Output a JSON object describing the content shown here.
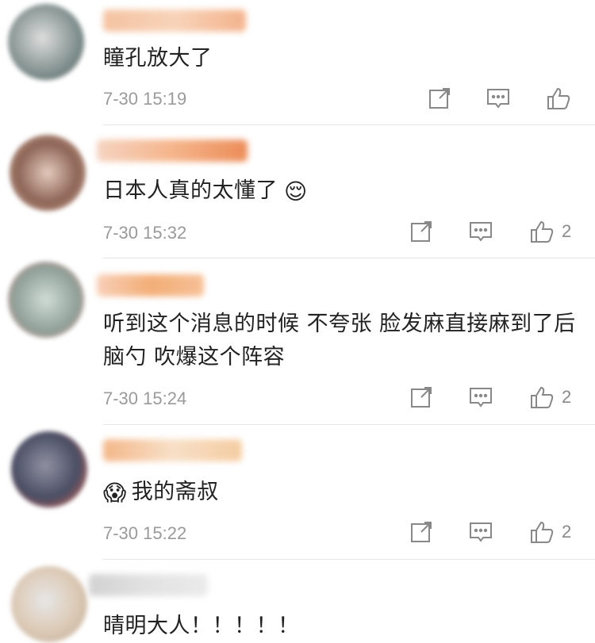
{
  "comments": [
    {
      "text": "瞳孔放大了",
      "time": "7-30 15:19",
      "likes": "",
      "avatar_colors": [
        "#c9c9c9",
        "#5a6e6b",
        "#e35b3c"
      ],
      "name_colors": [
        "#f2b48a",
        "#f7c9a8"
      ]
    },
    {
      "text": "日本人真的太懂了",
      "trailing_emoji": "😌",
      "time": "7-30 15:32",
      "likes": "2",
      "avatar_colors": [
        "#caa089",
        "#7a4b3a",
        "#e0c2b3"
      ],
      "name_colors": [
        "#f3a36f",
        "#e7702f"
      ]
    },
    {
      "text": "听到这个消息的时候 不夸张 脸发麻直接麻到了后脑勺 吹爆这个阵容",
      "time": "7-30 15:24",
      "likes": "2",
      "avatar_colors": [
        "#a8bfb7",
        "#7c8f87",
        "#e97a6f"
      ],
      "name_colors": [
        "#f7c3a6",
        "#f09b56"
      ]
    },
    {
      "text": "我的斋叔",
      "leading_emoji": "😱",
      "time": "7-30 15:22",
      "likes": "2",
      "avatar_colors": [
        "#2b2f4a",
        "#7d7f92",
        "#e34a2b"
      ],
      "name_colors": [
        "#f1a56c",
        "#f6d8b9"
      ]
    },
    {
      "text": "晴明大人！！！！！",
      "time": "",
      "likes": "",
      "avatar_colors": [
        "#d8c3ad",
        "#b39b80",
        "#e3e3e3"
      ],
      "name_colors": [
        "#c7c7c7",
        "#dcdcdc"
      ]
    }
  ],
  "icons": {
    "share": "share-icon",
    "comment": "comment-icon",
    "like": "thumbs-up-icon"
  }
}
